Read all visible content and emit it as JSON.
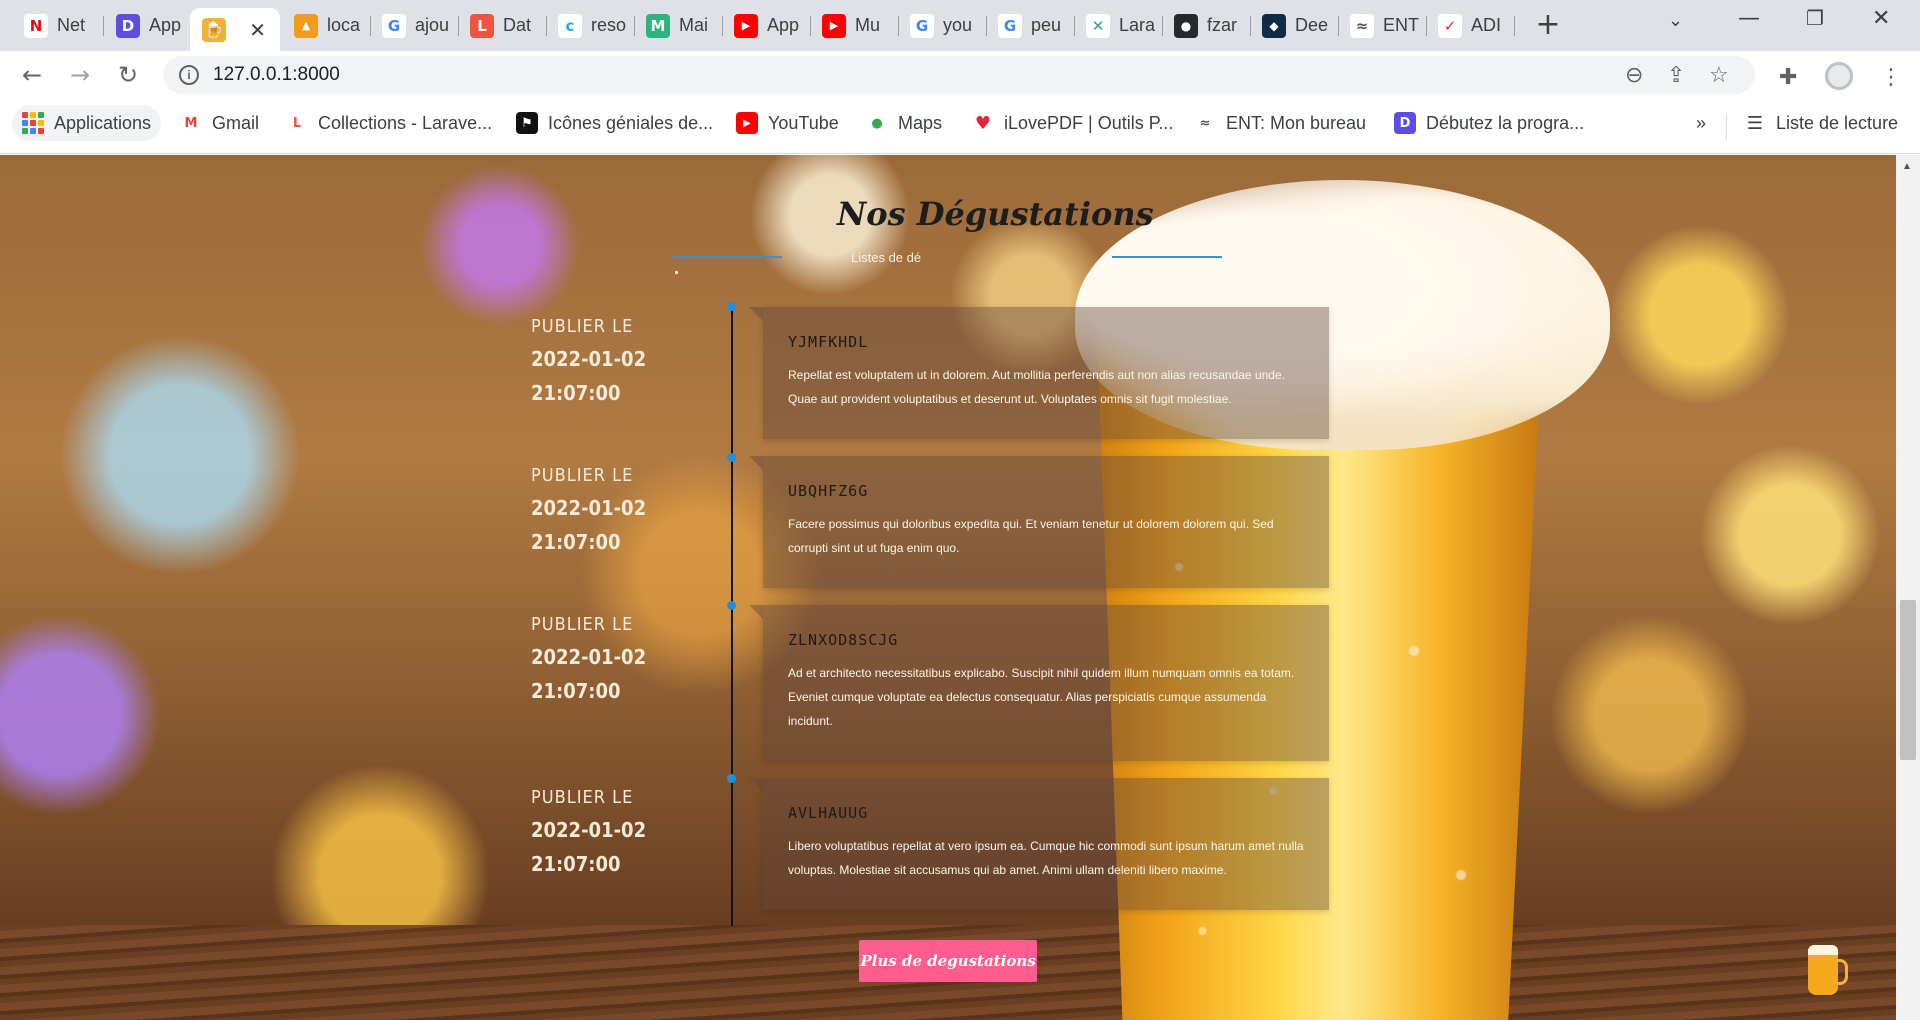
{
  "browser": {
    "tabs": [
      {
        "label": "Net",
        "icon": "netflix-icon",
        "color": "#e50914",
        "glyph": "N"
      },
      {
        "label": "App",
        "icon": "app-d-icon",
        "color": "#5b4ee0",
        "glyph": "D"
      },
      {
        "label": "",
        "icon": "beer-icon",
        "color": "#f2b233",
        "glyph": "🍺",
        "active": true
      },
      {
        "label": "loca",
        "icon": "phpmyadmin-icon",
        "color": "#f29c1f",
        "glyph": "▲"
      },
      {
        "label": "ajou",
        "icon": "google-icon",
        "color": "#4285f4",
        "glyph": "G"
      },
      {
        "label": "Dat",
        "icon": "laravel-icon",
        "color": "#f05340",
        "glyph": "L"
      },
      {
        "label": "reso",
        "icon": "c-icon",
        "color": "#27a7e7",
        "glyph": "c"
      },
      {
        "label": "Mai",
        "icon": "mail-icon",
        "color": "#2db37d",
        "glyph": "M"
      },
      {
        "label": "App",
        "icon": "youtube-icon",
        "color": "#ff0000",
        "glyph": "▶"
      },
      {
        "label": "Mu",
        "icon": "youtube-icon",
        "color": "#ff0000",
        "glyph": "▶"
      },
      {
        "label": "you",
        "icon": "google-icon",
        "color": "#4285f4",
        "glyph": "G"
      },
      {
        "label": "peu",
        "icon": "google-icon",
        "color": "#4285f4",
        "glyph": "G"
      },
      {
        "label": "Lara",
        "icon": "laracasts-icon",
        "color": "#2aa3a0",
        "glyph": "✕"
      },
      {
        "label": "fzar",
        "icon": "github-icon",
        "color": "#24292e",
        "glyph": "●"
      },
      {
        "label": "Dee",
        "icon": "deepl-icon",
        "color": "#0f2b46",
        "glyph": "◆"
      },
      {
        "label": "ENT",
        "icon": "ent-icon",
        "color": "#555555",
        "glyph": "≈"
      },
      {
        "label": "ADI",
        "icon": "adi-icon",
        "color": "#e3263b",
        "glyph": "✓"
      }
    ],
    "address": {
      "url": "127.0.0.1:8000"
    },
    "bookmarks": [
      {
        "label": "Applications",
        "icon": "apps-grid-icon"
      },
      {
        "label": "Gmail",
        "icon": "gmail-icon",
        "color": "#ea4335",
        "glyph": "M"
      },
      {
        "label": "Collections - Larave...",
        "icon": "laravel-icon",
        "color": "#f05340",
        "glyph": "L"
      },
      {
        "label": "Icônes géniales de...",
        "icon": "flag-icon",
        "color": "#111111",
        "glyph": "⚑"
      },
      {
        "label": "YouTube",
        "icon": "youtube-icon",
        "color": "#ff0000",
        "glyph": "▶"
      },
      {
        "label": "Maps",
        "icon": "maps-pin-icon",
        "color": "#34a853",
        "glyph": "●"
      },
      {
        "label": "iLovePDF | Outils P...",
        "icon": "heart-icon",
        "color": "#e3263b",
        "glyph": "♥"
      },
      {
        "label": "ENT: Mon bureau",
        "icon": "ent-icon",
        "color": "#555555",
        "glyph": "≈"
      },
      {
        "label": "Débutez la progra...",
        "icon": "app-d-icon",
        "color": "#5b4ee0",
        "glyph": "D"
      }
    ],
    "more_bookmarks": "»",
    "reading_list": "Liste de lecture"
  },
  "page": {
    "section_title": "Nos Dégustations",
    "section_subtitle": "Listes de dé",
    "timeline": [
      {
        "label": "PUBLIER LE",
        "date": "2022-01-02",
        "time": "21:07:00",
        "title": "YJMFKHDL",
        "text": "Repellat est voluptatem ut in dolorem. Aut mollitia perferendis aut non alias recusandae unde. Quae aut provident voluptatibus et deserunt ut. Voluptates omnis sit fugit molestiae."
      },
      {
        "label": "PUBLIER LE",
        "date": "2022-01-02",
        "time": "21:07:00",
        "title": "UBQHFZ6G",
        "text": "Facere possimus qui doloribus expedita qui. Et veniam tenetur ut dolorem dolorem qui. Sed corrupti sint ut ut fuga enim quo."
      },
      {
        "label": "PUBLIER LE",
        "date": "2022-01-02",
        "time": "21:07:00",
        "title": "ZLNXOD8SCJG",
        "text": "Ad et architecto necessitatibus explicabo. Suscipit nihil quidem illum numquam omnis ea totam. Eveniet cumque voluptate ea delectus consequatur. Alias perspiciatis cumque assumenda incidunt."
      },
      {
        "label": "PUBLIER LE",
        "date": "2022-01-02",
        "time": "21:07:00",
        "title": "AVLHAUUG",
        "text": "Libero voluptatibus repellat at vero ipsum ea. Cumque hic commodi sunt ipsum harum amet nulla voluptas. Molestiae sit accusamus qui ab amet. Animi ullam deleniti libero maxime."
      }
    ],
    "more_button": "Plus de degustations",
    "accent_color": "#ff5c8f",
    "timeline_dot_color": "#1e8fe0"
  }
}
